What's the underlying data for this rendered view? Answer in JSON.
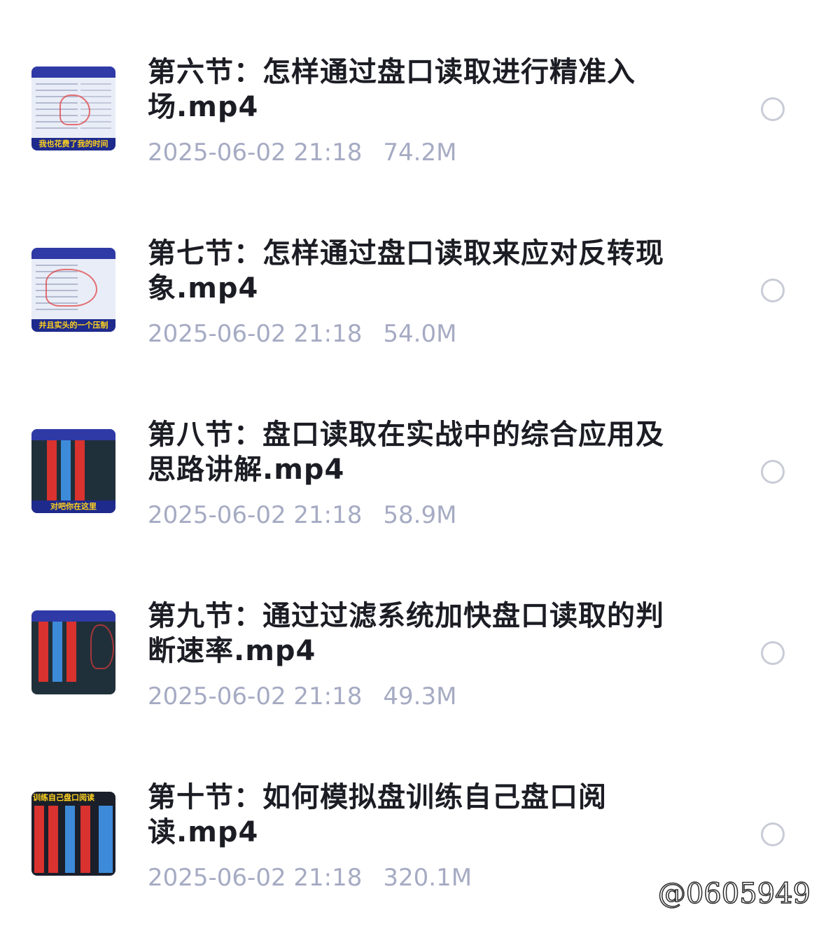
{
  "files": [
    {
      "title": "第六节：怎样通过盘口读取进行精准入场.mp4",
      "date": "2025-06-02 21:18",
      "size": "74.2M",
      "thumb_caption": "我也花费了我的时间"
    },
    {
      "title": "第七节：怎样通过盘口读取来应对反转现象.mp4",
      "date": "2025-06-02 21:18",
      "size": "54.0M",
      "thumb_caption": "并且实头的一个压制"
    },
    {
      "title": "第八节：盘口读取在实战中的综合应用及思路讲解.mp4",
      "date": "2025-06-02 21:18",
      "size": "58.9M",
      "thumb_caption": "对吧你在这里"
    },
    {
      "title": "第九节：通过过滤系统加快盘口读取的判断速率.mp4",
      "date": "2025-06-02 21:18",
      "size": "49.3M",
      "thumb_caption": ""
    },
    {
      "title": "第十节：如何模拟盘训练自己盘口阅读.mp4",
      "date": "2025-06-02 21:18",
      "size": "320.1M",
      "thumb_caption": "训练自己盘口阅读"
    }
  ],
  "watermark": "@0605949"
}
